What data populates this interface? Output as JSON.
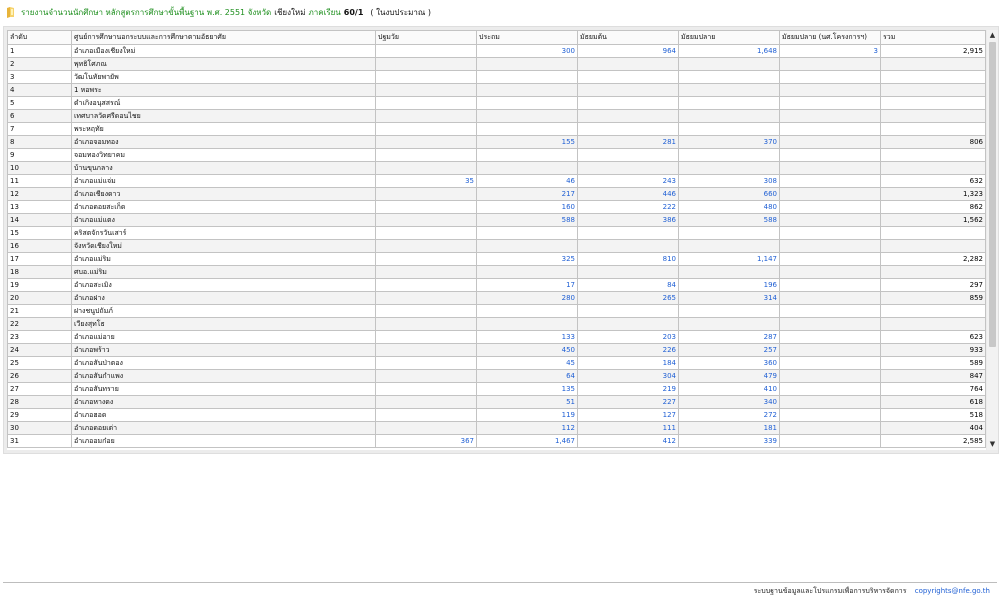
{
  "header": {
    "title_part1": "รายงานจำนวนนักศึกษา หลักสูตรการศึกษาขั้นพื้นฐาน พ.ศ. 2551 จังหวัด",
    "province": "เชียงใหม่",
    "term_label": "ภาคเรียน",
    "term": "60/1",
    "note": "( ในงบประมาณ )"
  },
  "table": {
    "columns": [
      "ลำดับ",
      "ศูนย์การศึกษานอกระบบและการศึกษาตามอัธยาศัย",
      "ปฐมวัย",
      "ประถม",
      "มัธยมต้น",
      "มัธยมปลาย",
      "มัธยมปลาย (นศ.โครงการฯ)",
      "รวม"
    ],
    "rows": [
      {
        "no": "1",
        "name": "อำเภอเมืองเชียงใหม่",
        "early": "",
        "primary": "300",
        "lower": "964",
        "upper": "1,648",
        "project": "3",
        "total": "2,915"
      },
      {
        "no": "2",
        "name": "พุทธิโศภณ",
        "early": "",
        "primary": "",
        "lower": "",
        "upper": "",
        "project": "",
        "total": ""
      },
      {
        "no": "3",
        "name": "วัฒโนทัยพายัพ",
        "early": "",
        "primary": "",
        "lower": "",
        "upper": "",
        "project": "",
        "total": ""
      },
      {
        "no": "4",
        "name": "1 หอพระ",
        "early": "",
        "primary": "",
        "lower": "",
        "upper": "",
        "project": "",
        "total": ""
      },
      {
        "no": "5",
        "name": "ดำเกิงอนุสสรณ์",
        "early": "",
        "primary": "",
        "lower": "",
        "upper": "",
        "project": "",
        "total": ""
      },
      {
        "no": "6",
        "name": "เทศบาลวัดศรีดอนไชย",
        "early": "",
        "primary": "",
        "lower": "",
        "upper": "",
        "project": "",
        "total": ""
      },
      {
        "no": "7",
        "name": "พระหฤทัย",
        "early": "",
        "primary": "",
        "lower": "",
        "upper": "",
        "project": "",
        "total": ""
      },
      {
        "no": "8",
        "name": "อำเภอจอมทอง",
        "early": "",
        "primary": "155",
        "lower": "281",
        "upper": "370",
        "project": "",
        "total": "806"
      },
      {
        "no": "9",
        "name": "จอมทองวิทยาคม",
        "early": "",
        "primary": "",
        "lower": "",
        "upper": "",
        "project": "",
        "total": ""
      },
      {
        "no": "10",
        "name": "บ้านขุนกลาง",
        "early": "",
        "primary": "",
        "lower": "",
        "upper": "",
        "project": "",
        "total": ""
      },
      {
        "no": "11",
        "name": "อำเภอแม่แจ่ม",
        "early": "35",
        "primary": "46",
        "lower": "243",
        "upper": "308",
        "project": "",
        "total": "632"
      },
      {
        "no": "12",
        "name": "อำเภอเชียงดาว",
        "early": "",
        "primary": "217",
        "lower": "446",
        "upper": "660",
        "project": "",
        "total": "1,323"
      },
      {
        "no": "13",
        "name": "อำเภอดอยสะเก็ด",
        "early": "",
        "primary": "160",
        "lower": "222",
        "upper": "480",
        "project": "",
        "total": "862"
      },
      {
        "no": "14",
        "name": "อำเภอแม่แตง",
        "early": "",
        "primary": "588",
        "lower": "386",
        "upper": "588",
        "project": "",
        "total": "1,562"
      },
      {
        "no": "15",
        "name": "คริสตจักรวันเสาร์",
        "early": "",
        "primary": "",
        "lower": "",
        "upper": "",
        "project": "",
        "total": ""
      },
      {
        "no": "16",
        "name": "จังหวัดเชียงใหม่",
        "early": "",
        "primary": "",
        "lower": "",
        "upper": "",
        "project": "",
        "total": ""
      },
      {
        "no": "17",
        "name": "อำเภอแม่ริม",
        "early": "",
        "primary": "325",
        "lower": "810",
        "upper": "1,147",
        "project": "",
        "total": "2,282"
      },
      {
        "no": "18",
        "name": "ศบอ.แม่ริม",
        "early": "",
        "primary": "",
        "lower": "",
        "upper": "",
        "project": "",
        "total": ""
      },
      {
        "no": "19",
        "name": "อำเภอสะเมิง",
        "early": "",
        "primary": "17",
        "lower": "84",
        "upper": "196",
        "project": "",
        "total": "297"
      },
      {
        "no": "20",
        "name": "อำเภอฝาง",
        "early": "",
        "primary": "280",
        "lower": "265",
        "upper": "314",
        "project": "",
        "total": "859"
      },
      {
        "no": "21",
        "name": "ฝางชนูปถัมภ์",
        "early": "",
        "primary": "",
        "lower": "",
        "upper": "",
        "project": "",
        "total": ""
      },
      {
        "no": "22",
        "name": "เวียงสุทโธ",
        "early": "",
        "primary": "",
        "lower": "",
        "upper": "",
        "project": "",
        "total": ""
      },
      {
        "no": "23",
        "name": "อำเภอแม่อาย",
        "early": "",
        "primary": "133",
        "lower": "203",
        "upper": "287",
        "project": "",
        "total": "623"
      },
      {
        "no": "24",
        "name": "อำเภอพร้าว",
        "early": "",
        "primary": "450",
        "lower": "226",
        "upper": "257",
        "project": "",
        "total": "933"
      },
      {
        "no": "25",
        "name": "อำเภอสันป่าตอง",
        "early": "",
        "primary": "45",
        "lower": "184",
        "upper": "360",
        "project": "",
        "total": "589"
      },
      {
        "no": "26",
        "name": "อำเภอสันกำแพง",
        "early": "",
        "primary": "64",
        "lower": "304",
        "upper": "479",
        "project": "",
        "total": "847"
      },
      {
        "no": "27",
        "name": "อำเภอสันทราย",
        "early": "",
        "primary": "135",
        "lower": "219",
        "upper": "410",
        "project": "",
        "total": "764"
      },
      {
        "no": "28",
        "name": "อำเภอหางดง",
        "early": "",
        "primary": "51",
        "lower": "227",
        "upper": "340",
        "project": "",
        "total": "618"
      },
      {
        "no": "29",
        "name": "อำเภอฮอด",
        "early": "",
        "primary": "119",
        "lower": "127",
        "upper": "272",
        "project": "",
        "total": "518"
      },
      {
        "no": "30",
        "name": "อำเภอดอยเต่า",
        "early": "",
        "primary": "112",
        "lower": "111",
        "upper": "181",
        "project": "",
        "total": "404"
      },
      {
        "no": "31",
        "name": "อำเภออมก๋อย",
        "early": "367",
        "primary": "1,467",
        "lower": "412",
        "upper": "339",
        "project": "",
        "total": "2,585"
      }
    ]
  },
  "footer": {
    "text": "ระบบฐานข้อมูลและโปรแกรมเพื่อการบริหารจัดการ",
    "link": "copyrights@nfe.go.th"
  },
  "icons": {
    "title": "folder-icon",
    "scroll_up": "scroll-up-arrow-icon",
    "scroll_down": "scroll-down-arrow-icon"
  },
  "colors": {
    "title_green": "#1e8f1e",
    "number_blue": "#1f5fd4",
    "row_alt": "#f3f3f3",
    "grid_border": "#c3c3c3"
  }
}
